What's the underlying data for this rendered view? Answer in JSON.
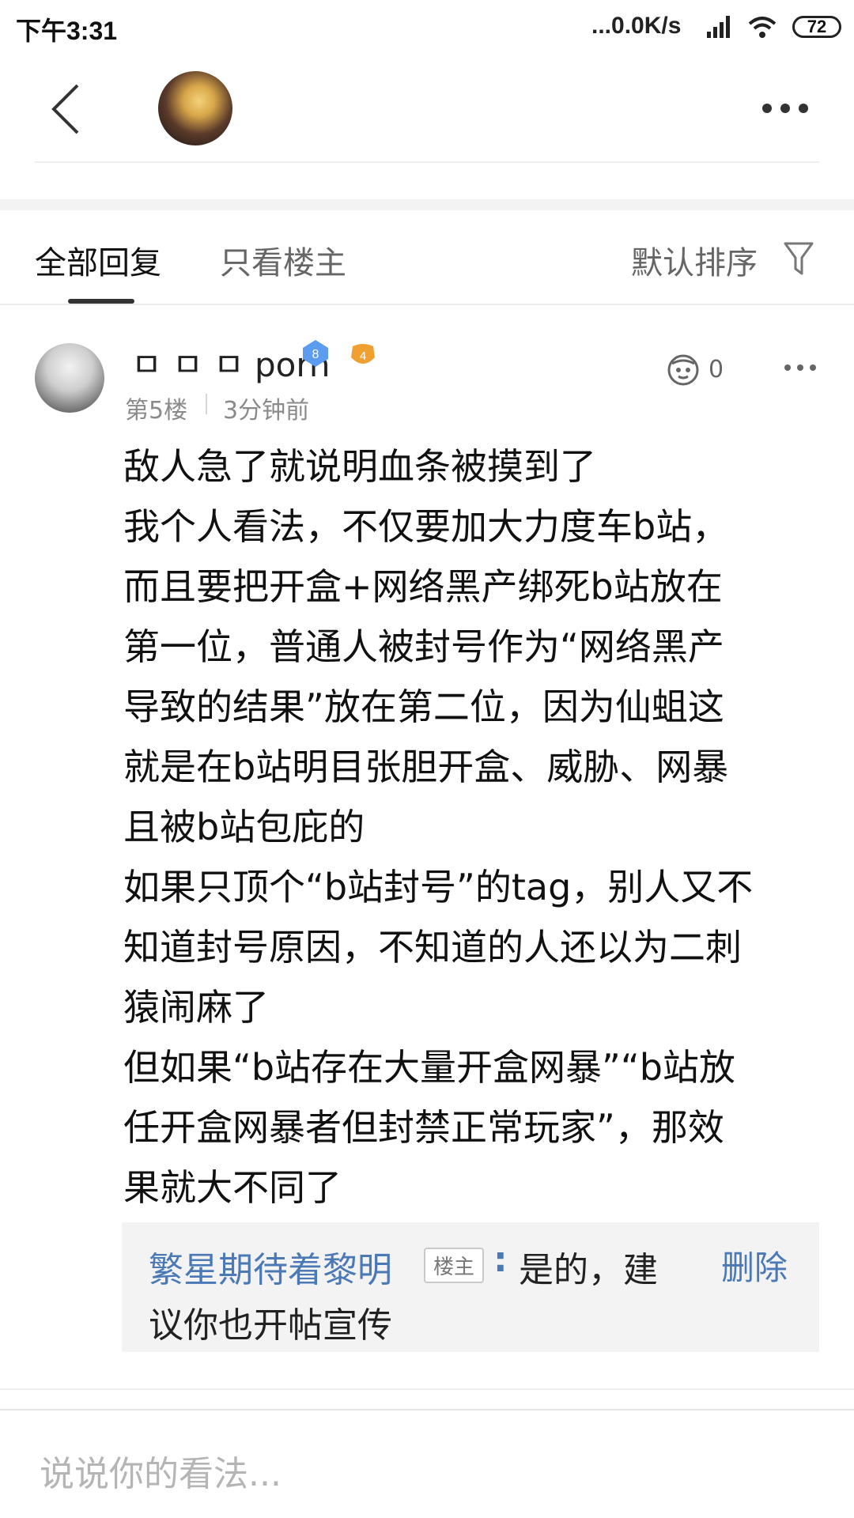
{
  "status_bar": {
    "time": "下午3:31",
    "net_speed": "...0.0K/s",
    "battery": "72"
  },
  "header": {
    "back_icon": "chevron-left-icon",
    "more_icon": "more-horizontal-icon"
  },
  "tabs": {
    "all_label": "全部回复",
    "op_only_label": "只看楼主",
    "sort_label": "默认排序",
    "filter_icon": "filter-icon"
  },
  "comment": {
    "username": "ㅁ ㅁ ㅁ porn",
    "level": "8",
    "fan_level": "4",
    "floor": "第5楼",
    "time_ago": "3分钟前",
    "like_count": "0",
    "lines": [
      "敌人急了就说明血条被摸到了",
      "我个人看法，不仅要加大力度车b站，",
      "而且要把开盒+网络黑产绑死b站放在",
      "第一位，普通人被封号作为“网络黑产",
      "导致的结果”放在第二位，因为仙蛆这",
      "就是在b站明目张胆开盒、威胁、网暴",
      "且被b站包庇的",
      "如果只顶个“b站封号”的tag，别人又不",
      "知道封号原因，不知道的人还以为二刺",
      "猿闹麻了",
      "但如果“b站存在大量开盒网暴”“b站放",
      "任开盒网暴者但封禁正常玩家”，那效",
      "果就大不同了"
    ]
  },
  "reply": {
    "author": "繁星期待着黎明",
    "op_tag": "楼主",
    "colon": ":",
    "text_line1": "是的，建",
    "text_line2": "议你也开帖宣传",
    "delete_label": "删除"
  },
  "input": {
    "placeholder": "说说你的看法..."
  },
  "colors": {
    "link_blue": "#4a79b5",
    "badge_blue": "#5b9cf0",
    "fan_orange": "#f0a030"
  }
}
